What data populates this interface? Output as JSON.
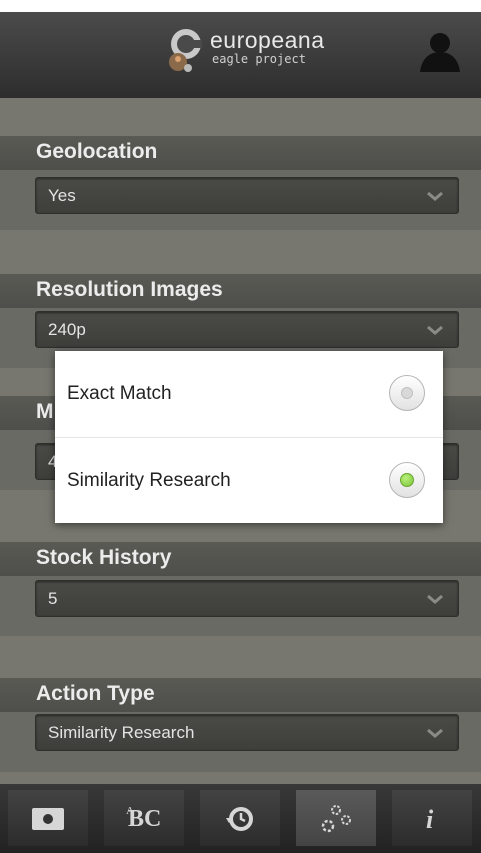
{
  "header": {
    "logo_title": "europeana",
    "logo_subtitle": "eagle project",
    "user_icon": "user-icon"
  },
  "settings": [
    {
      "title": "Geolocation",
      "value": "Yes"
    },
    {
      "title": "Resolution Images",
      "value": "240p"
    },
    {
      "title": "M",
      "value": "4"
    },
    {
      "title": "Stock History",
      "value": "5"
    },
    {
      "title": "Action Type",
      "value": "Similarity Research"
    }
  ],
  "dialog": {
    "options": [
      {
        "label": "Exact Match",
        "selected": false
      },
      {
        "label": "Similarity Research",
        "selected": true
      }
    ]
  },
  "tabbar": {
    "tabs": [
      {
        "icon": "camera-icon",
        "active": false
      },
      {
        "icon": "text-recognition-icon",
        "active": false
      },
      {
        "icon": "history-icon",
        "active": false
      },
      {
        "icon": "settings-gears-icon",
        "active": true
      },
      {
        "icon": "info-icon",
        "active": false
      }
    ]
  },
  "colors": {
    "accent_selected": "#7cc43a",
    "header_bg": "#3a3a3a",
    "content_bg": "#6f6f6a"
  }
}
